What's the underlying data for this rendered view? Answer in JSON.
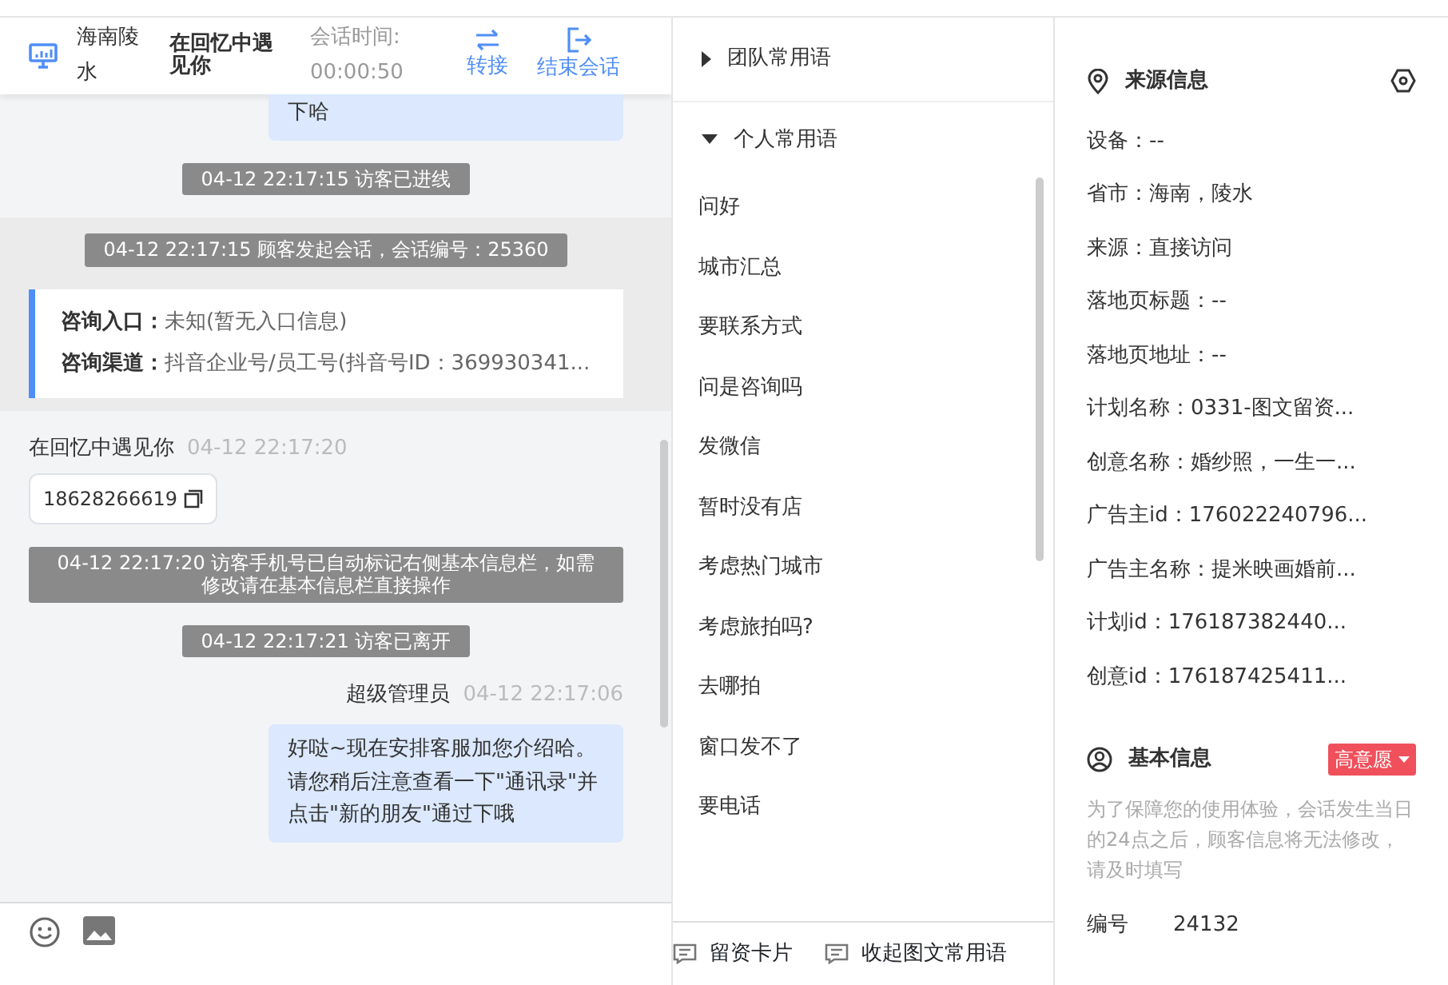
{
  "header": {
    "location": "海南陵水",
    "visitor": "在回忆中遇见你",
    "time_label": "会话时间:",
    "time": "00:00:50",
    "actions": [
      {
        "label": "转接",
        "kind": "transfer"
      },
      {
        "label": "结束会话",
        "kind": "exit"
      }
    ]
  },
  "messages": [
    {
      "kind": "agent",
      "text": "下哈"
    },
    {
      "kind": "system",
      "text": "04-12 22:17:15 访客已进线"
    },
    {
      "kind": "session",
      "notice": "04-12 22:17:15 顾客发起会话，会话编号：25360",
      "rows": [
        {
          "label": "咨询入口：",
          "value": "未知(暂无入口信息)"
        },
        {
          "label": "咨询渠道：",
          "value": "抖音企业号/员工号(抖音号ID：369930341..."
        }
      ]
    },
    {
      "kind": "visitor",
      "name": "在回忆中遇见你",
      "time": "04-12 22:17:20",
      "phone": "18628266619"
    },
    {
      "kind": "system",
      "text": "04-12 22:17:20 访客手机号已自动标记右侧基本信息栏，如需修改请在基本信息栏直接操作"
    },
    {
      "kind": "system",
      "text": "04-12 22:17:21 访客已离开"
    },
    {
      "kind": "agent",
      "name": "超级管理员",
      "time": "04-12 22:17:06",
      "text": "好哒~现在安排客服加您介绍哈。请您稍后注意查看一下\"通讯录\"并点击\"新的朋友\"通过下哦"
    }
  ],
  "phrases": [
    {
      "title": "团队常用语",
      "expanded": false
    },
    {
      "title": "个人常用语",
      "expanded": true,
      "items": [
        "问好",
        "城市汇总",
        "要联系方式",
        "问是咨询吗",
        "发微信",
        "暂时没有店",
        "考虑热门城市",
        "考虑旅拍吗?",
        "去哪拍",
        "窗口发不了",
        "要电话"
      ]
    }
  ],
  "bottom_buttons": [
    "留资卡片",
    "收起图文常用语"
  ],
  "source": {
    "title": "来源信息",
    "rows": [
      "设备：--",
      "省市：海南，陵水",
      "来源：直接访问",
      "落地页标题：--",
      "落地页地址：--",
      "计划名称：0331-图文留资...",
      "创意名称：婚纱照，一生一...",
      "广告主id：176022240796...",
      "广告主名称：提米映画婚前...",
      "计划id：176187382440...",
      "创意id：176187425411..."
    ]
  },
  "basic": {
    "title": "基本信息",
    "tag": "高意愿",
    "note": "为了保障您的使用体验，会话发生当日的24点之后，顾客信息将无法修改，请及时填写",
    "fields": [
      {
        "label": "编号",
        "value": "24132"
      }
    ]
  }
}
